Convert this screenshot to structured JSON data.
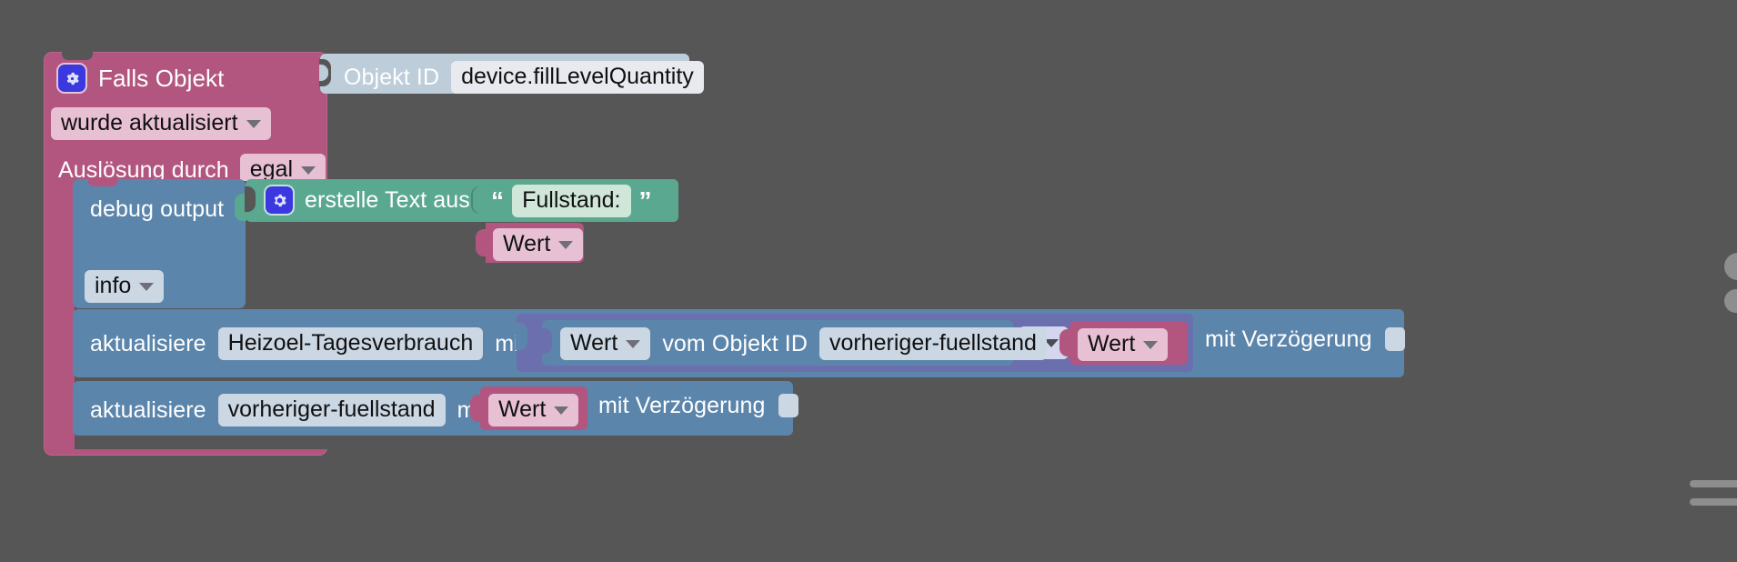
{
  "workspace": {
    "background_color": "#565656"
  },
  "event_block": {
    "color": "#b2567f",
    "gear_icon": "gear-icon",
    "title": "Falls Objekt",
    "condition_dropdown": "wurde aktualisiert",
    "trigger_label": "Auslösung durch",
    "trigger_dropdown": "egal"
  },
  "objekt_id_block": {
    "color": "#bdcdda",
    "label": "Objekt ID",
    "value": "device.fillLevelQuantity"
  },
  "debug_block": {
    "color": "#5c85ab",
    "label": "debug output",
    "severity_dropdown": "info"
  },
  "text_join_block": {
    "color": "#5ba890",
    "gear_icon": "gear-icon",
    "label": "erstelle Text aus",
    "open_quote": "“",
    "close_quote": "”",
    "string_value": "Fullstand:",
    "operand_dropdown": "Wert"
  },
  "update_block_1": {
    "color": "#5c85ab",
    "label": "aktualisiere",
    "object_id": "Heizoel-Tagesverbrauch",
    "with_label": "mit",
    "delay_label": "mit Verzögerung",
    "delay_checked": false,
    "math_block": {
      "color": "#6b6fad",
      "operator_dropdown": "-",
      "left_operand": {
        "color": "#5c85ab",
        "value_dropdown": "Wert",
        "label": "vom Objekt ID",
        "object_id": "vorheriger-fuellstand"
      },
      "right_operand": {
        "color": "#b2567f",
        "value_dropdown": "Wert"
      }
    }
  },
  "update_block_2": {
    "color": "#5c85ab",
    "label": "aktualisiere",
    "object_id": "vorheriger-fuellstand",
    "with_label": "mit",
    "value_dropdown": "Wert",
    "delay_label": "mit Verzögerung",
    "delay_checked": false
  }
}
